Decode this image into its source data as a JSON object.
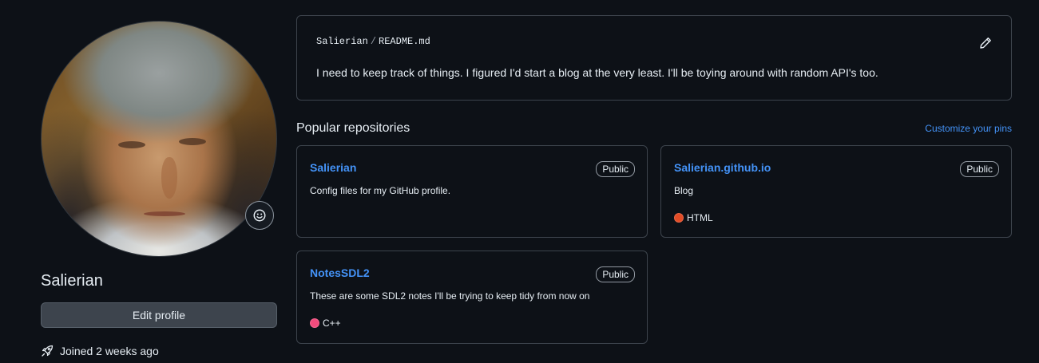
{
  "profile": {
    "name": "Salierian",
    "edit_label": "Edit profile",
    "joined": "Joined 2 weeks ago",
    "avatar_icon": "portrait-avatar",
    "status_icon": "smiley-icon"
  },
  "readme": {
    "owner": "Salierian",
    "separator": "/",
    "file": "README.md",
    "body": "I need to keep track of things. I figured I'd start a blog at the very least. I'll be toying around with random API's too.",
    "edit_icon": "pencil-icon"
  },
  "popular": {
    "title": "Popular repositories",
    "customize": "Customize your pins",
    "repos": [
      {
        "name": "Salierian",
        "visibility": "Public",
        "description": "Config files for my GitHub profile."
      },
      {
        "name": "Salierian.github.io",
        "visibility": "Public",
        "description": "Blog",
        "language": "HTML",
        "language_color": "#e34c26"
      },
      {
        "name": "NotesSDL2",
        "visibility": "Public",
        "description": "These are some SDL2 notes I'll be trying to keep tidy from now on",
        "language": "C++",
        "language_color": "#f34b7d"
      }
    ]
  },
  "colors": {
    "background": "#0d1117",
    "link": "#4493f8",
    "border": "#3d444d"
  }
}
